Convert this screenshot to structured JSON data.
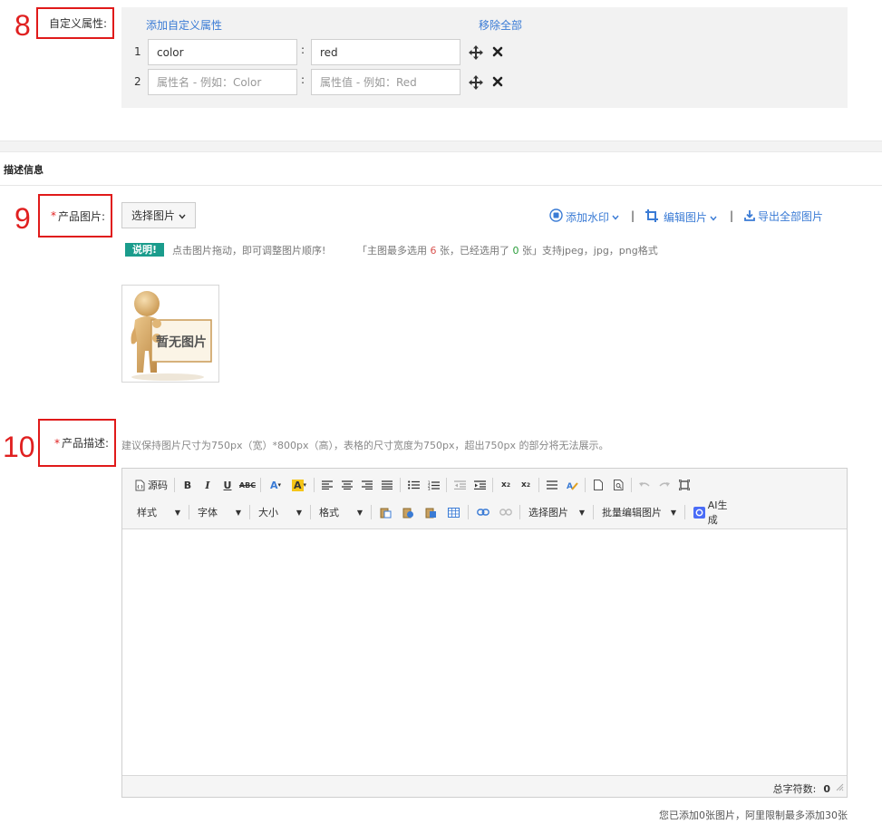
{
  "annotations": {
    "step8": "8",
    "step9": "9",
    "step10": "10"
  },
  "custom_attr": {
    "label": "自定义属性:",
    "add_link": "添加自定义属性",
    "remove_all": "移除全部",
    "rows": [
      {
        "index": "1",
        "name_value": "color",
        "name_placeholder": "",
        "value_value": "red",
        "value_placeholder": ""
      },
      {
        "index": "2",
        "name_value": "",
        "name_placeholder": "属性名 - 例如：Color",
        "value_value": "",
        "value_placeholder": "属性值 - 例如：Red"
      }
    ],
    "colon": ":"
  },
  "section": {
    "title": "描述信息"
  },
  "product_image": {
    "required_mark": "*",
    "label": "产品图片:",
    "select_button": "选择图片",
    "watermark": "添加水印",
    "edit_image": "编辑图片",
    "export_all": "导出全部图片",
    "separator": "|",
    "badge": "说明!",
    "drag_hint": "点击图片拖动，即可调整图片顺序!",
    "limit_prefix": "「主图最多选用",
    "limit_max": "6",
    "limit_mid": "张，已经选用了",
    "limit_used": "0",
    "limit_suffix": "张」支持jpeg，jpg，png格式",
    "placeholder_text": "暂无图片"
  },
  "product_desc": {
    "required_mark": "*",
    "label": "产品描述:",
    "hint": "建议保持图片尺寸为750px（宽）*800px（高），表格的尺寸宽度为750px，超出750px 的部分将无法展示。",
    "toolbar": {
      "source": "源码",
      "style": "样式",
      "font": "字体",
      "size": "大小",
      "format": "格式",
      "select_image": "选择图片",
      "batch_edit": "批量编辑图片",
      "ai_generate": "AI生成"
    },
    "char_count_label": "总字符数:",
    "char_count": "0"
  },
  "bottom_note": "您已添加0张图片，阿里限制最多添加30张",
  "colors": {
    "link": "#3a7bd5",
    "annotation_red": "#e01a1a",
    "badge": "#1a9c8c"
  }
}
